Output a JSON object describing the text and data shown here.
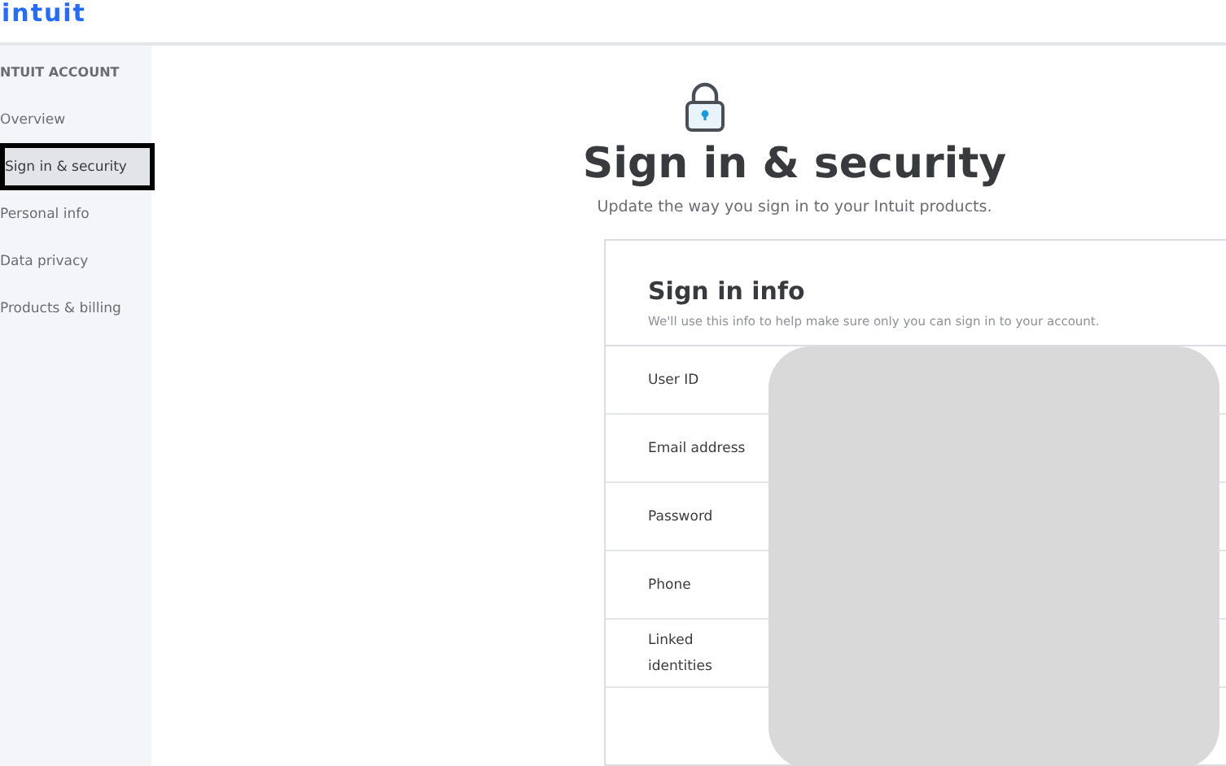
{
  "logo": "intuit",
  "sidebar": {
    "heading": "NTUIT ACCOUNT",
    "items": [
      {
        "label": "Overview",
        "selected": false
      },
      {
        "label": "Sign in & security",
        "selected": true
      },
      {
        "label": "Personal info",
        "selected": false
      },
      {
        "label": "Data privacy",
        "selected": false
      },
      {
        "label": "Products & billing",
        "selected": false
      }
    ]
  },
  "page": {
    "title": "Sign in & security",
    "subtitle": "Update the way you sign in to your Intuit products."
  },
  "card": {
    "title": "Sign in info",
    "description": "We'll use this info to help make sure only you can sign in to your account.",
    "rows": [
      {
        "label": "User ID"
      },
      {
        "label": "Email address"
      },
      {
        "label": "Password"
      },
      {
        "label": "Phone"
      },
      {
        "label": "Linked identities"
      }
    ]
  }
}
